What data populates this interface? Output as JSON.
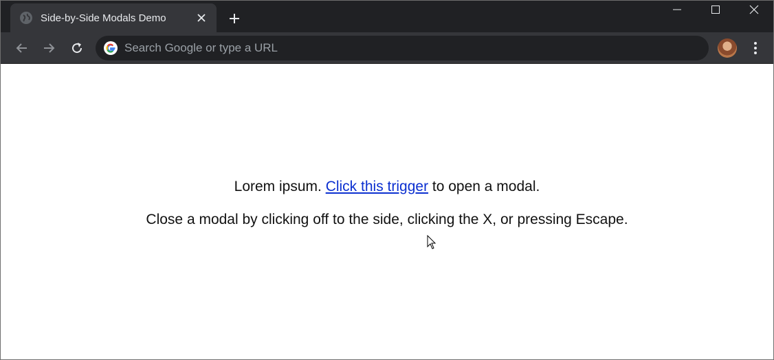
{
  "browser": {
    "tab": {
      "title": "Side-by-Side Modals Demo",
      "favicon": "globe-icon"
    },
    "new_tab_icon": "plus-icon",
    "window_controls": [
      "minimize-icon",
      "maximize-icon",
      "close-icon"
    ],
    "nav": {
      "back": "back-arrow-icon",
      "forward": "forward-arrow-icon",
      "reload": "reload-icon"
    },
    "omnibox": {
      "placeholder": "Search Google or type a URL",
      "value": ""
    },
    "colors": {
      "frame": "#202124",
      "toolbar": "#35363a",
      "omnibox": "#202124",
      "tab_text": "#e8eaed",
      "placeholder": "#9aa0a6"
    }
  },
  "page": {
    "line1_before": "Lorem ipsum. ",
    "trigger_link": "Click this trigger",
    "line1_after": " to open a modal.",
    "line2": "Close a modal by clicking off to the side, clicking the X, or pressing Escape.",
    "link_color": "#0b2fd0"
  }
}
